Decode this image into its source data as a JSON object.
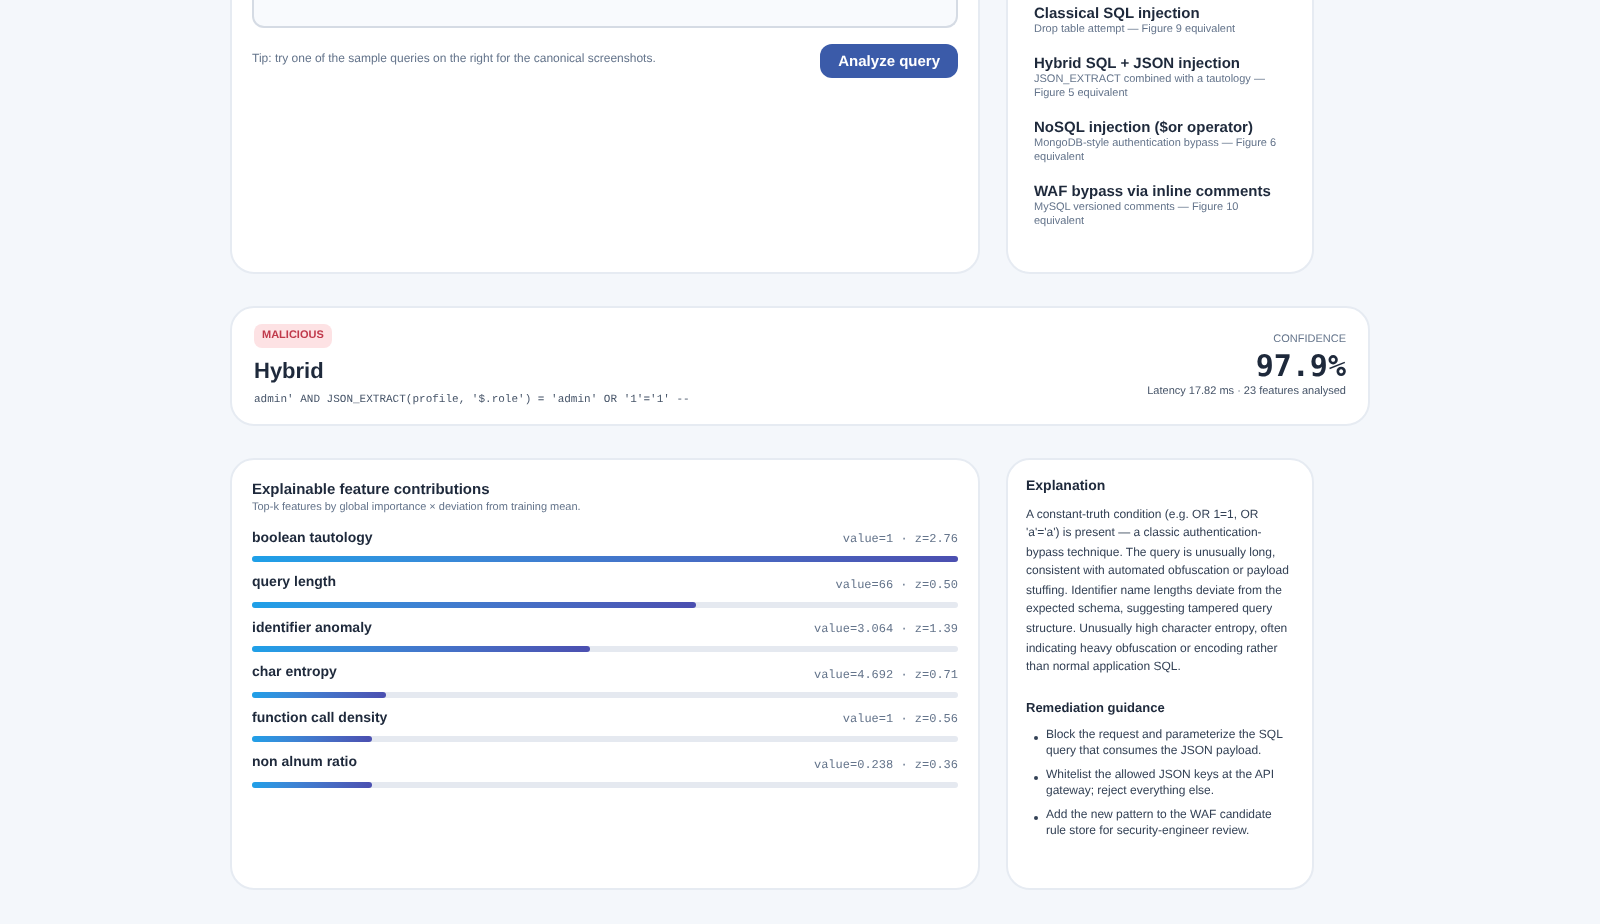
{
  "query_panel": {
    "tip": "Tip: try one of the sample queries on the right for the canonical screenshots.",
    "analyze_button": "Analyze query"
  },
  "samples": [
    {
      "title": "Classical SQL injection",
      "description": "Drop table attempt — Figure 9 equivalent"
    },
    {
      "title": "Hybrid SQL + JSON injection",
      "description": "JSON_EXTRACT combined with a tautology — Figure 5 equivalent"
    },
    {
      "title": "NoSQL injection ($or operator)",
      "description": "MongoDB-style authentication bypass — Figure 6 equivalent"
    },
    {
      "title": "WAF bypass via inline comments",
      "description": "MySQL versioned comments — Figure 10 equivalent"
    }
  ],
  "result": {
    "verdict": "MALICIOUS",
    "category": "Hybrid",
    "query": "admin' AND JSON_EXTRACT(profile, '$.role') = 'admin' OR '1'='1' --",
    "confidence_label": "CONFIDENCE",
    "confidence": "97.9%",
    "meta": "Latency 17.82 ms · 23 features analysed"
  },
  "features": {
    "title": "Explainable feature contributions",
    "subtitle": "Top-k features by global importance × deviation from training mean.",
    "items": [
      {
        "name": "boolean tautology",
        "reading": "value=1 · z=2.76",
        "level": 1.0
      },
      {
        "name": "query length",
        "reading": "value=66 · z=0.50",
        "level": 0.63
      },
      {
        "name": "identifier anomaly",
        "reading": "value=3.064 · z=1.39",
        "level": 0.48
      },
      {
        "name": "char entropy",
        "reading": "value=4.692 · z=0.71",
        "level": 0.19
      },
      {
        "name": "function call density",
        "reading": "value=1 · z=0.56",
        "level": 0.17
      },
      {
        "name": "non alnum ratio",
        "reading": "value=0.238 · z=0.36",
        "level": 0.17
      }
    ]
  },
  "explanation": {
    "title": "Explanation",
    "text": "A constant-truth condition (e.g. OR 1=1, OR 'a'='a') is present — a classic authentication-bypass technique. The query is unusually long, consistent with automated obfuscation or payload stuffing. Identifier name lengths deviate from the expected schema, suggesting tampered query structure. Unusually high character entropy, often indicating heavy obfuscation or encoding rather than normal application SQL.",
    "remediation_title": "Remediation guidance",
    "remediation": [
      "Block the request and parameterize the SQL query that consumes the JSON payload.",
      "Whitelist the allowed JSON keys at the API gateway; reject everything else.",
      "Add the new pattern to the WAF candidate rule store for security-engineer review."
    ]
  }
}
